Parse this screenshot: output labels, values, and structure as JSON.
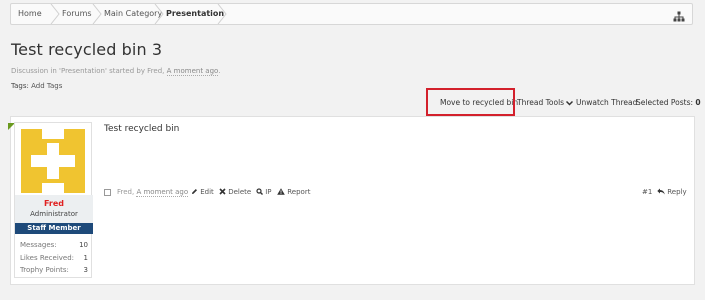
{
  "breadcrumb": {
    "items": [
      "Home",
      "Forums",
      "Main Category",
      "Presentation"
    ]
  },
  "thread": {
    "title": "Test recycled bin 3",
    "meta_prefix": "Discussion in 'Presentation' started by Fred,",
    "meta_time": "A moment ago",
    "meta_suffix": ".",
    "tags_label": "Tags:",
    "tags_link": "Add Tags"
  },
  "toolbar": {
    "move_to_recycled_bin": "Move to recycled bin",
    "thread_tools": "Thread Tools",
    "unwatch": "Unwatch Thread",
    "selected_posts_label": "Selected Posts:",
    "selected_posts_count": "0"
  },
  "post": {
    "message": "Test recycled bin",
    "author_prefix": "Fred,",
    "time": "A moment ago",
    "edit": "Edit",
    "delete": "Delete",
    "ip": "IP",
    "report": "Report",
    "number": "#1",
    "reply": "Reply"
  },
  "user": {
    "name": "Fred",
    "title": "Administrator",
    "banner": "Staff Member",
    "stats": [
      {
        "label": "Messages:",
        "value": "10"
      },
      {
        "label": "Likes Received:",
        "value": "1"
      },
      {
        "label": "Trophy Points:",
        "value": "3"
      }
    ]
  },
  "colors": {
    "username": "#e02020",
    "staff_banner": "#1e4a7a",
    "highlight": "#d3202c",
    "avatar": "#f0c430"
  }
}
